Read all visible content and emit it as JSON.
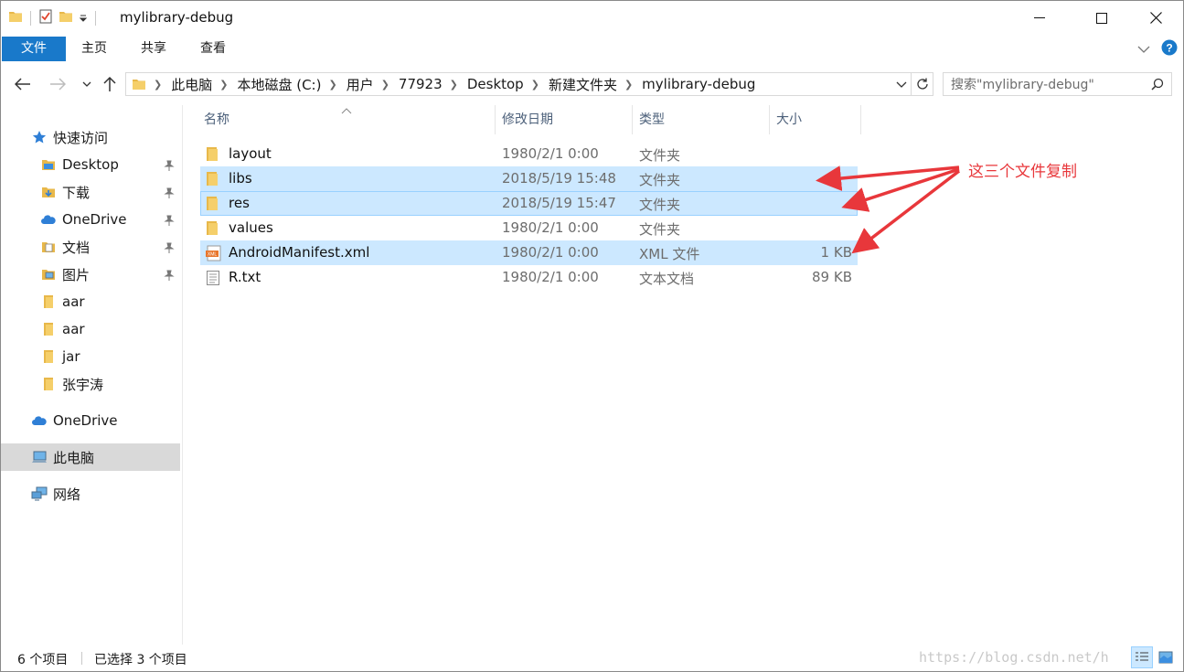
{
  "window": {
    "title": "mylibrary-debug"
  },
  "ribbon": {
    "tabs": [
      "文件",
      "主页",
      "共享",
      "查看"
    ]
  },
  "address": {
    "crumbs": [
      "此电脑",
      "本地磁盘 (C:)",
      "用户",
      "77923",
      "Desktop",
      "新建文件夹",
      "mylibrary-debug"
    ]
  },
  "search": {
    "placeholder": "搜索\"mylibrary-debug\""
  },
  "sidebar": {
    "items": [
      {
        "label": "快速访问",
        "icon": "star-icon",
        "pinned": false
      },
      {
        "label": "Desktop",
        "icon": "desktop-folder-icon",
        "pinned": true
      },
      {
        "label": "下载",
        "icon": "download-folder-icon",
        "pinned": true
      },
      {
        "label": "OneDrive",
        "icon": "cloud-icon",
        "pinned": true
      },
      {
        "label": "文档",
        "icon": "documents-folder-icon",
        "pinned": true
      },
      {
        "label": "图片",
        "icon": "pictures-folder-icon",
        "pinned": true
      },
      {
        "label": "aar",
        "icon": "folder-icon",
        "pinned": false
      },
      {
        "label": "aar",
        "icon": "folder-icon",
        "pinned": false
      },
      {
        "label": "jar",
        "icon": "folder-icon",
        "pinned": false
      },
      {
        "label": "张宇涛",
        "icon": "folder-icon",
        "pinned": false
      },
      {
        "label": "OneDrive",
        "icon": "cloud-icon",
        "pinned": false
      },
      {
        "label": "此电脑",
        "icon": "computer-icon",
        "pinned": false
      },
      {
        "label": "网络",
        "icon": "network-icon",
        "pinned": false
      }
    ]
  },
  "columns": {
    "name": "名称",
    "date": "修改日期",
    "type": "类型",
    "size": "大小"
  },
  "files": [
    {
      "name": "layout",
      "date": "1980/2/1 0:00",
      "type": "文件夹",
      "size": "",
      "icon": "folder-icon",
      "selected": false
    },
    {
      "name": "libs",
      "date": "2018/5/19 15:48",
      "type": "文件夹",
      "size": "",
      "icon": "folder-icon",
      "selected": true
    },
    {
      "name": "res",
      "date": "2018/5/19 15:47",
      "type": "文件夹",
      "size": "",
      "icon": "folder-icon",
      "selected": true
    },
    {
      "name": "values",
      "date": "1980/2/1 0:00",
      "type": "文件夹",
      "size": "",
      "icon": "folder-icon",
      "selected": false
    },
    {
      "name": "AndroidManifest.xml",
      "date": "1980/2/1 0:00",
      "type": "XML 文件",
      "size": "1 KB",
      "icon": "xml-file-icon",
      "selected": true
    },
    {
      "name": "R.txt",
      "date": "1980/2/1 0:00",
      "type": "文本文档",
      "size": "89 KB",
      "icon": "text-file-icon",
      "selected": false
    }
  ],
  "annotation": {
    "text": "这三个文件复制",
    "color": "#e8373b"
  },
  "status": {
    "count": "6 个项目",
    "selected": "已选择 3 个项目",
    "watermark": "https://blog.csdn.net/h"
  },
  "colors": {
    "accent": "#1979ca",
    "selection": "#cce8ff",
    "folder": "#e8b84a"
  }
}
